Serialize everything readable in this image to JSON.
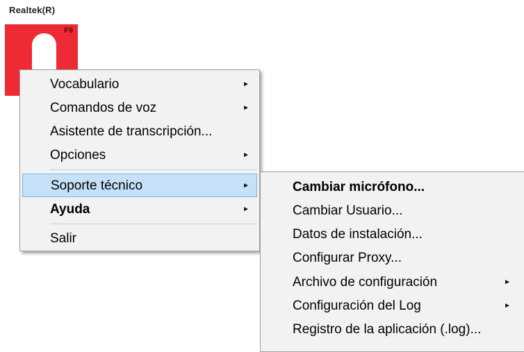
{
  "device": {
    "name": "Realtek(R)",
    "hotkey": "F9",
    "tile_color": "#ee2b34"
  },
  "context_menu": {
    "items": [
      {
        "label": "Vocabulario"
      },
      {
        "label": "Comandos de voz"
      },
      {
        "label": "Asistente de transcripción..."
      },
      {
        "label": "Opciones"
      },
      {
        "label": "Soporte técnico"
      },
      {
        "label": "Ayuda"
      },
      {
        "label": "Salir"
      }
    ],
    "highlight_color": "#c5e0f7"
  },
  "submenu": {
    "items": [
      {
        "label": "Cambiar micrófono..."
      },
      {
        "label": "Cambiar Usuario..."
      },
      {
        "label": "Datos de instalación..."
      },
      {
        "label": "Configurar Proxy..."
      },
      {
        "label": "Archivo de configuración"
      },
      {
        "label": "Configuración del Log"
      },
      {
        "label": "Registro de la aplicación (.log)..."
      }
    ]
  },
  "icons": {
    "submenu_arrow": "right-triangle",
    "microphone": "microphone-icon"
  }
}
